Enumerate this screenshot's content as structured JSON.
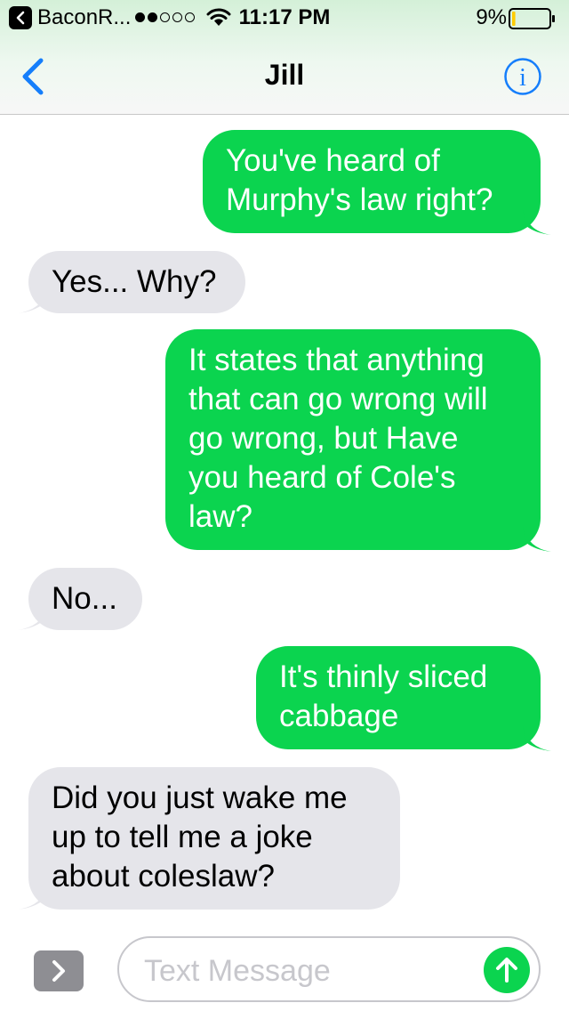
{
  "status_bar": {
    "back_app": "BaconR...",
    "signal_bars_filled": 2,
    "signal_bars_total": 5,
    "time": "11:17 PM",
    "battery": "9%",
    "battery_level": 0.09
  },
  "nav": {
    "title": "Jill"
  },
  "messages": [
    {
      "direction": "outgoing",
      "text": "You've heard of\nMurphy's law right?"
    },
    {
      "direction": "incoming",
      "text": "Yes... Why?"
    },
    {
      "direction": "outgoing",
      "text": "It states that anything\nthat can go wrong will\ngo wrong, but Have\nyou heard of Cole's\nlaw?"
    },
    {
      "direction": "incoming",
      "text": "No..."
    },
    {
      "direction": "outgoing",
      "text": "It's thinly sliced\ncabbage"
    },
    {
      "direction": "incoming",
      "text": "Did you just wake me\nup to tell me a joke\nabout coleslaw?"
    }
  ],
  "composer": {
    "placeholder": "Text Message",
    "value": ""
  },
  "colors": {
    "outgoing_bubble": "#0bd44f",
    "incoming_bubble": "#e5e5ea",
    "accent_blue": "#157efb",
    "battery_fill": "#ffcc00"
  }
}
